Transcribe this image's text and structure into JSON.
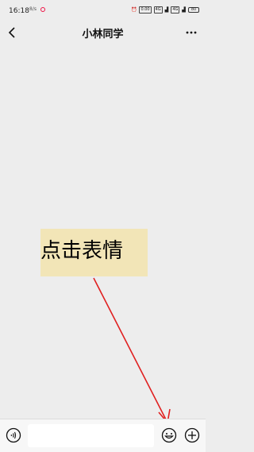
{
  "status_bar": {
    "time": "16:18",
    "signal_left": "8/s",
    "speed_label": "0.00\nK/s",
    "network_1": "4G",
    "network_2": "4G",
    "battery": "80"
  },
  "header": {
    "title": "小林同学",
    "back_icon": "chevron-left-icon",
    "more_icon": "more-dots-icon"
  },
  "annotation": {
    "text": "点击表情",
    "box_color": "#f2e5b7",
    "arrow_color": "#e02020"
  },
  "input_bar": {
    "voice_icon": "voice-icon",
    "input_value": "",
    "input_placeholder": "",
    "emoji_icon": "emoji-icon",
    "plus_icon": "plus-circle-icon"
  }
}
